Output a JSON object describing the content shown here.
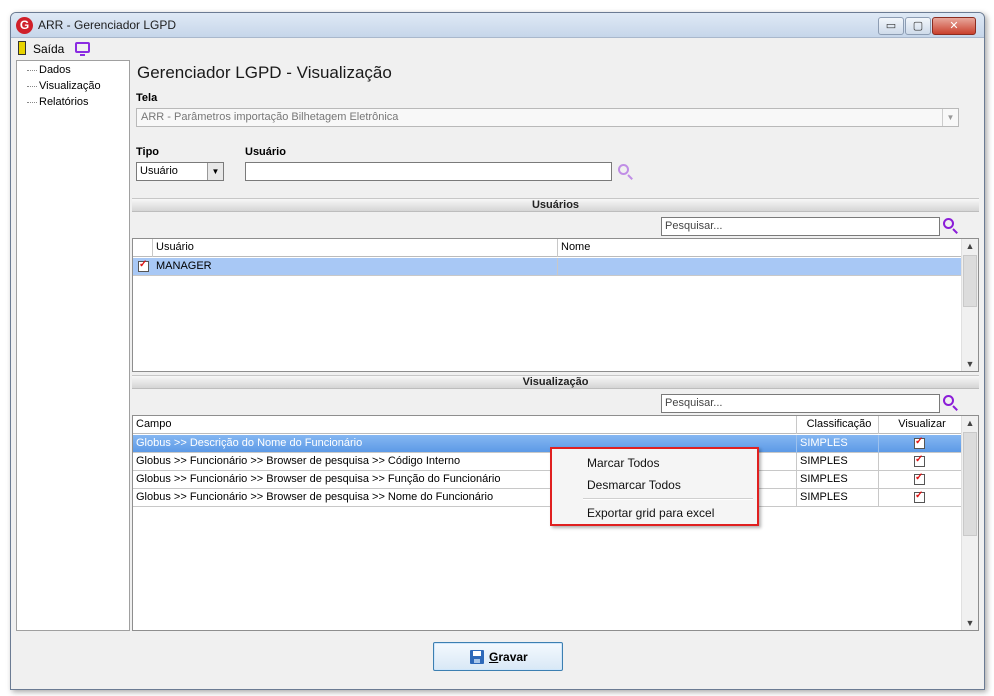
{
  "window": {
    "title": "ARR - Gerenciador LGPD",
    "app_icon_letter": "G"
  },
  "window_controls": {
    "minimize": "▭",
    "maximize": "▢",
    "close": "✕"
  },
  "menubar": {
    "exit_label": "Saída",
    "exit_icon": "exit-door-icon",
    "monitor_icon": "monitor-icon"
  },
  "sidebar": {
    "items": [
      {
        "label": "Dados"
      },
      {
        "label": "Visualização"
      },
      {
        "label": "Relatórios"
      }
    ]
  },
  "main": {
    "title": "Gerenciador LGPD - Visualização",
    "tela_label": "Tela",
    "tela_value": "ARR - Parâmetros importação Bilhetagem Eletrônica",
    "tipo_label": "Tipo",
    "tipo_value": "Usuário",
    "usuario_label": "Usuário",
    "usuario_value": ""
  },
  "users_section": {
    "title": "Usuários",
    "search_placeholder": "Pesquisar...",
    "columns": [
      "Usuário",
      "Nome"
    ],
    "rows": [
      {
        "checked": true,
        "usuario": "MANAGER",
        "nome": ""
      }
    ]
  },
  "view_section": {
    "title": "Visualização",
    "search_placeholder": "Pesquisar...",
    "columns": [
      "Campo",
      "Classificação",
      "Visualizar"
    ],
    "rows": [
      {
        "campo": "Globus >> Descrição do Nome do Funcionário",
        "classificacao": "SIMPLES",
        "visualizar": true
      },
      {
        "campo": "Globus >> Funcionário >> Browser de pesquisa >> Código Interno",
        "classificacao": "SIMPLES",
        "visualizar": true
      },
      {
        "campo": "Globus >> Funcionário >> Browser de pesquisa >> Função do Funcionário",
        "classificacao": "SIMPLES",
        "visualizar": true
      },
      {
        "campo": "Globus >> Funcionário >> Browser de pesquisa >> Nome do Funcionário",
        "classificacao": "SIMPLES",
        "visualizar": true
      }
    ]
  },
  "context_menu": {
    "items": [
      "Marcar Todos",
      "Desmarcar Todos",
      "Exportar grid para excel"
    ]
  },
  "footer": {
    "save_label": "Gravar"
  },
  "colors": {
    "accent_purple": "#8b1dd8",
    "selected_row": "#5d9ae6",
    "context_border": "#e02020"
  }
}
